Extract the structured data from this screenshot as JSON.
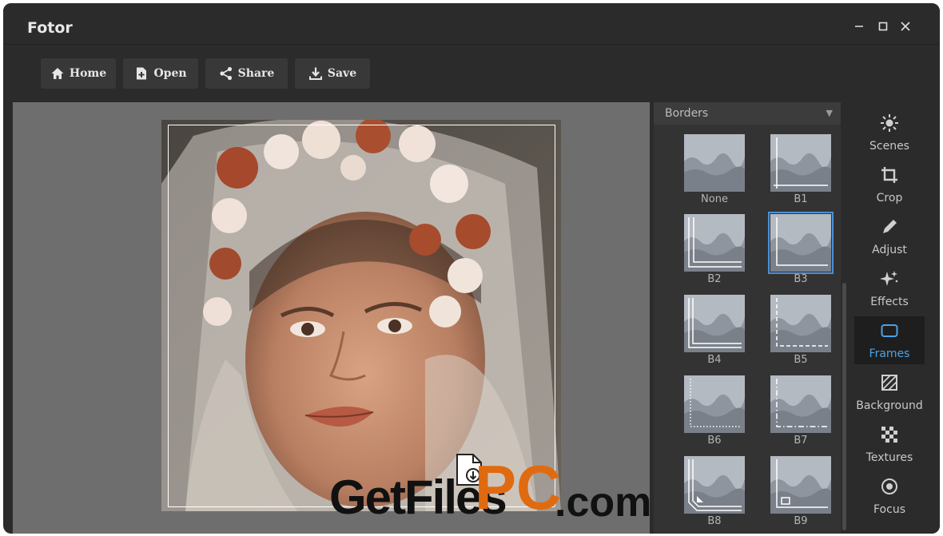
{
  "window": {
    "title": "Fotor"
  },
  "toolbar": {
    "home_label": "Home",
    "open_label": "Open",
    "share_label": "Share",
    "save_label": "Save"
  },
  "borders_panel": {
    "header": "Borders",
    "items": [
      {
        "label": "None"
      },
      {
        "label": "B1"
      },
      {
        "label": "B2"
      },
      {
        "label": "B3",
        "selected": true
      },
      {
        "label": "B4"
      },
      {
        "label": "B5"
      },
      {
        "label": "B6"
      },
      {
        "label": "B7"
      },
      {
        "label": "B8"
      },
      {
        "label": "B9"
      }
    ]
  },
  "side_nav": {
    "items": [
      {
        "label": "Scenes",
        "icon": "sun-icon"
      },
      {
        "label": "Crop",
        "icon": "crop-icon"
      },
      {
        "label": "Adjust",
        "icon": "pencil-icon"
      },
      {
        "label": "Effects",
        "icon": "sparkle-icon"
      },
      {
        "label": "Frames",
        "icon": "frame-icon",
        "active": true
      },
      {
        "label": "Background",
        "icon": "background-icon"
      },
      {
        "label": "Textures",
        "icon": "texture-icon"
      },
      {
        "label": "Focus",
        "icon": "focus-icon"
      }
    ]
  },
  "watermark": {
    "part1": "GetFiles",
    "part2": "PC",
    "part3": ".com"
  },
  "colors": {
    "accent": "#4a90d9",
    "active_nav": "#4aa3e8",
    "watermark_orange": "#e06a10"
  }
}
